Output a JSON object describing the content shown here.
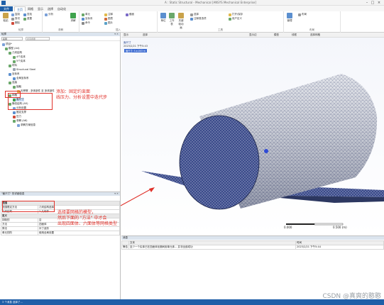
{
  "window": {
    "title": "A : Static Structural - Mechanical [ANSYS Mechanical Enterprise]"
  },
  "tabs": [
    "文件",
    "主页",
    "网格",
    "显示",
    "选择",
    "自动化"
  ],
  "ribbon": {
    "groups": [
      "轮廓",
      "求解",
      "插入",
      "工具",
      "布局"
    ],
    "buttons": [
      "复制",
      "剪切",
      "粘贴",
      "删除",
      "查找",
      "重置",
      "分析",
      "求解",
      "单元",
      "坐标系",
      "命令",
      "注释",
      "图表",
      "图片",
      "截面",
      "单位",
      "工作表",
      "关键帧动画",
      "选择",
      "注释首选项",
      "打开/保存",
      "用户定义",
      "管理",
      "布局"
    ]
  },
  "outline": {
    "title": "轮廓",
    "filter": "名称",
    "search_placeholder": "搜索概要",
    "tree": [
      "项目*",
      "模型 (A4)",
      "几何结构",
      "4个实体",
      "5个实体",
      "材料",
      "Structural Steel",
      "坐标系",
      "全局坐标系",
      "连接",
      "接触",
      "无摩擦 - 多体部件 至 多体部件",
      "网格",
      "面尺寸",
      "静态结构 (A5)",
      "分析设置",
      "固定支撑",
      "压力",
      "求解 (A6)",
      "求解方案信息"
    ]
  },
  "details": {
    "title": "\"面尺寸\" 的详细信息",
    "rows": [
      {
        "k": "范围",
        "v": ""
      },
      {
        "k": "范围限定方法",
        "v": "几何结构选择"
      },
      {
        "k": "几何结构",
        "v": "2 几何体"
      },
      {
        "k": "定义",
        "v": ""
      },
      {
        "k": "抑制的",
        "v": "否"
      },
      {
        "k": "方法",
        "v": "四面体"
      },
      {
        "k": "算法",
        "v": "补丁适形"
      },
      {
        "k": "单元的阶",
        "v": "使用全局设置"
      }
    ]
  },
  "graphics": {
    "toolbar": [
      "显示",
      "选择",
      "显示边",
      "模型",
      "线框",
      "选择网格"
    ],
    "title_lines": [
      "面尺寸",
      "2023/2/21 下午5:43",
      "面尺寸"
    ],
    "legend": "面尺寸: 5.e-003 m",
    "scale_left": "0.000",
    "scale_right": "0.500 (m)"
  },
  "messages": {
    "title": "消息",
    "headers": [
      "",
      "文本",
      "时间"
    ],
    "rows": [
      {
        "type": "警告",
        "text": "至少一个实体已在四面体化期间用单元体... 并非全部成功",
        "time": "2023/2/21 下午5:44"
      }
    ]
  },
  "status": {
    "text": "3 个消息 选择了..."
  },
  "watermark": "CSDN @真爽的憨憨",
  "annotations": {
    "top": "添加：固定约束面\n线压力、分析设置中迭代步",
    "bottom": "选择要网格的模型，\n然后下面的 \"方法\" 中才会\n出现四面体、六面体等网格类型"
  },
  "colors": {
    "accent": "#1f5fa8",
    "annotation": "#e0312a",
    "mesh_blue": "#3a4a8a"
  }
}
